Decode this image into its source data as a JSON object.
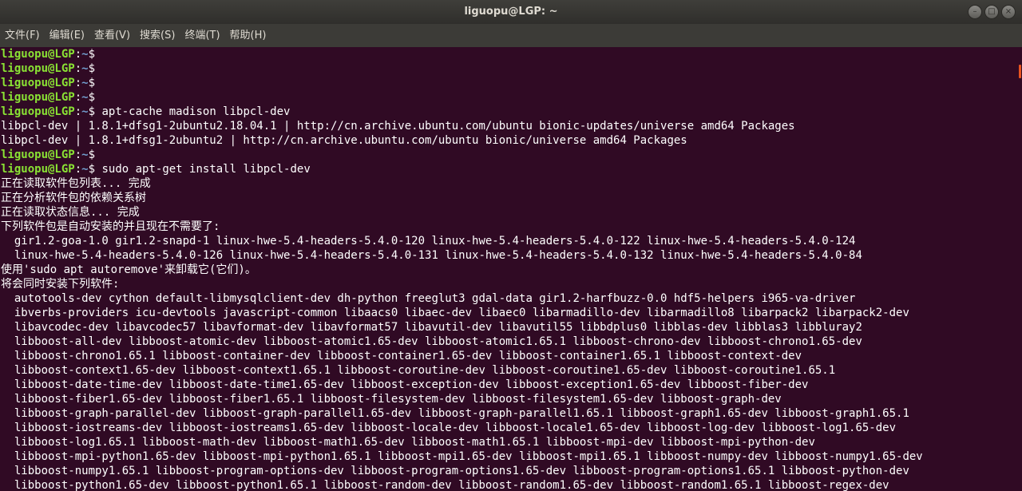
{
  "window": {
    "title": "liguopu@LGP: ~",
    "buttons": [
      {
        "name": "minimize",
        "glyph": "–"
      },
      {
        "name": "maximize",
        "glyph": "□"
      },
      {
        "name": "close",
        "glyph": "×"
      }
    ]
  },
  "menu": {
    "items": [
      "文件(F)",
      "编辑(E)",
      "查看(V)",
      "搜索(S)",
      "终端(T)",
      "帮助(H)"
    ]
  },
  "prompt": {
    "user_host": "liguopu@LGP",
    "separator": ":",
    "path": "~",
    "symbol": "$"
  },
  "terminal": {
    "lines": [
      {
        "type": "prompt",
        "cmd": ""
      },
      {
        "type": "prompt",
        "cmd": ""
      },
      {
        "type": "prompt",
        "cmd": ""
      },
      {
        "type": "prompt",
        "cmd": ""
      },
      {
        "type": "prompt",
        "cmd": " apt-cache madison libpcl-dev"
      },
      {
        "type": "output",
        "text": "libpcl-dev | 1.8.1+dfsg1-2ubuntu2.18.04.1 | http://cn.archive.ubuntu.com/ubuntu bionic-updates/universe amd64 Packages"
      },
      {
        "type": "output",
        "text": "libpcl-dev | 1.8.1+dfsg1-2ubuntu2 | http://cn.archive.ubuntu.com/ubuntu bionic/universe amd64 Packages"
      },
      {
        "type": "prompt",
        "cmd": ""
      },
      {
        "type": "prompt",
        "cmd": " sudo apt-get install libpcl-dev"
      },
      {
        "type": "output",
        "text": "正在读取软件包列表... 完成"
      },
      {
        "type": "output",
        "text": "正在分析软件包的依赖关系树"
      },
      {
        "type": "output",
        "text": "正在读取状态信息... 完成"
      },
      {
        "type": "output",
        "text": "下列软件包是自动安装的并且现在不需要了:"
      },
      {
        "type": "output",
        "text": "  gir1.2-goa-1.0 gir1.2-snapd-1 linux-hwe-5.4-headers-5.4.0-120 linux-hwe-5.4-headers-5.4.0-122 linux-hwe-5.4-headers-5.4.0-124"
      },
      {
        "type": "output",
        "text": "  linux-hwe-5.4-headers-5.4.0-126 linux-hwe-5.4-headers-5.4.0-131 linux-hwe-5.4-headers-5.4.0-132 linux-hwe-5.4-headers-5.4.0-84"
      },
      {
        "type": "output",
        "text": "使用'sudo apt autoremove'来卸载它(它们)。"
      },
      {
        "type": "output",
        "text": "将会同时安装下列软件:"
      },
      {
        "type": "output",
        "text": "  autotools-dev cython default-libmysqlclient-dev dh-python freeglut3 gdal-data gir1.2-harfbuzz-0.0 hdf5-helpers i965-va-driver"
      },
      {
        "type": "output",
        "text": "  ibverbs-providers icu-devtools javascript-common libaacs0 libaec-dev libaec0 libarmadillo-dev libarmadillo8 libarpack2 libarpack2-dev"
      },
      {
        "type": "output",
        "text": "  libavcodec-dev libavcodec57 libavformat-dev libavformat57 libavutil-dev libavutil55 libbdplus0 libblas-dev libblas3 libbluray2"
      },
      {
        "type": "output",
        "text": "  libboost-all-dev libboost-atomic-dev libboost-atomic1.65-dev libboost-atomic1.65.1 libboost-chrono-dev libboost-chrono1.65-dev"
      },
      {
        "type": "output",
        "text": "  libboost-chrono1.65.1 libboost-container-dev libboost-container1.65-dev libboost-container1.65.1 libboost-context-dev"
      },
      {
        "type": "output",
        "text": "  libboost-context1.65-dev libboost-context1.65.1 libboost-coroutine-dev libboost-coroutine1.65-dev libboost-coroutine1.65.1"
      },
      {
        "type": "output",
        "text": "  libboost-date-time-dev libboost-date-time1.65-dev libboost-exception-dev libboost-exception1.65-dev libboost-fiber-dev"
      },
      {
        "type": "output",
        "text": "  libboost-fiber1.65-dev libboost-fiber1.65.1 libboost-filesystem-dev libboost-filesystem1.65-dev libboost-graph-dev"
      },
      {
        "type": "output",
        "text": "  libboost-graph-parallel-dev libboost-graph-parallel1.65-dev libboost-graph-parallel1.65.1 libboost-graph1.65-dev libboost-graph1.65.1"
      },
      {
        "type": "output",
        "text": "  libboost-iostreams-dev libboost-iostreams1.65-dev libboost-locale-dev libboost-locale1.65-dev libboost-log-dev libboost-log1.65-dev"
      },
      {
        "type": "output",
        "text": "  libboost-log1.65.1 libboost-math-dev libboost-math1.65-dev libboost-math1.65.1 libboost-mpi-dev libboost-mpi-python-dev"
      },
      {
        "type": "output",
        "text": "  libboost-mpi-python1.65-dev libboost-mpi-python1.65.1 libboost-mpi1.65-dev libboost-mpi1.65.1 libboost-numpy-dev libboost-numpy1.65-dev"
      },
      {
        "type": "output",
        "text": "  libboost-numpy1.65.1 libboost-program-options-dev libboost-program-options1.65-dev libboost-program-options1.65.1 libboost-python-dev"
      },
      {
        "type": "output",
        "text": "  libboost-python1.65-dev libboost-python1.65.1 libboost-random-dev libboost-random1.65-dev libboost-random1.65.1 libboost-regex-dev"
      }
    ]
  },
  "colors": {
    "background": "#300a24",
    "prompt_user": "#8ae234",
    "prompt_path": "#729fcf",
    "text": "#ffffff",
    "scroll_accent": "#e95420"
  }
}
